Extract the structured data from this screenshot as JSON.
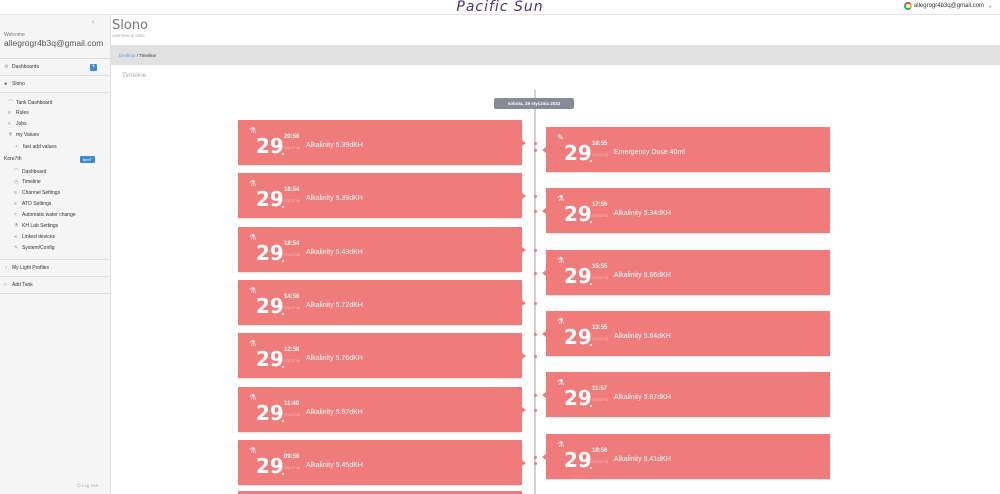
{
  "brand": "Pacific Sun",
  "user_email": "allegrogr4b3q@gmail.com",
  "user_caret": "▼",
  "sidebar": {
    "collapse_icon": "‹",
    "welcome": "Welcome",
    "email": "allegrogr4b3q@gmail.com",
    "items": [
      {
        "label": "Dashboards",
        "icon": "dashboard-icon"
      },
      {
        "label": "Slono",
        "icon": "fish-icon"
      },
      {
        "label": "Tank Dashboard",
        "icon": "chart-icon"
      },
      {
        "label": "Rules",
        "icon": "rules-icon"
      },
      {
        "label": "Jobs",
        "icon": "jobs-icon"
      },
      {
        "label": "my Values",
        "icon": "flask-icon"
      },
      {
        "label": "fast add values",
        "icon": "plus-icon"
      },
      {
        "label": "Kore7th",
        "icon": ""
      },
      {
        "label": "Dashboard",
        "icon": "chart-icon"
      },
      {
        "label": "Timeline",
        "icon": "clock-icon"
      },
      {
        "label": "Channel Settings",
        "icon": "sliders-icon"
      },
      {
        "label": "ATO Settings",
        "icon": "sliders-icon"
      },
      {
        "label": "Automatic water change",
        "icon": "water-icon"
      },
      {
        "label": "KH Lab Settings",
        "icon": "lab-icon"
      },
      {
        "label": "Linked devices",
        "icon": "link-icon"
      },
      {
        "label": "System/Config",
        "icon": "wrench-icon"
      },
      {
        "label": "My Light Profiles",
        "icon": "bulb-icon"
      },
      {
        "label": "Add Tank",
        "icon": "square-icon"
      }
    ],
    "badge": "beeT",
    "add_button": "+",
    "logout": "Log Out"
  },
  "page": {
    "title": "Slono",
    "subtitle": "overview & stats",
    "breadcrumb_home": "Desktop",
    "breadcrumb_sep": "/",
    "breadcrumb_current": "Timeline",
    "section": "Timeline"
  },
  "timeline": {
    "date_badge": "sobota, 29 stycznia 2022",
    "left": [
      {
        "day": "29",
        "time": "20:56",
        "month": "stycznia",
        "text": "Alkalinity 5.39dKH",
        "icon": "flask-icon"
      },
      {
        "day": "29",
        "time": "18:54",
        "month": "stycznia",
        "text": "Alkalinity 5.39dKH",
        "icon": "flask-icon"
      },
      {
        "day": "29",
        "time": "18:54",
        "month": "stycznia",
        "text": "Alkalinity 5.43dKH",
        "icon": "flask-icon"
      },
      {
        "day": "29",
        "time": "14:56",
        "month": "stycznia",
        "text": "Alkalinity 5.72dKH",
        "icon": "flask-icon"
      },
      {
        "day": "29",
        "time": "12:56",
        "month": "stycznia",
        "text": "Alkalinity 5.76dKH",
        "icon": "flask-icon"
      },
      {
        "day": "29",
        "time": "11:40",
        "month": "stycznia",
        "text": "Alkalinity 5.97dKH",
        "icon": "flask-icon"
      },
      {
        "day": "29",
        "time": "09:56",
        "month": "stycznia",
        "text": "Alkalinity 5.45dKH",
        "icon": "flask-icon"
      }
    ],
    "right": [
      {
        "day": "29",
        "time": "18:55",
        "month": "stycznia",
        "text": "Emergency Dose 40ml",
        "icon": "syringe-icon"
      },
      {
        "day": "29",
        "time": "17:55",
        "month": "stycznia",
        "text": "Alkalinity 5.34dKH",
        "icon": "flask-icon"
      },
      {
        "day": "29",
        "time": "15:55",
        "month": "stycznia",
        "text": "Alkalinity 5.66dKH",
        "icon": "flask-icon"
      },
      {
        "day": "29",
        "time": "13:55",
        "month": "stycznia",
        "text": "Alkalinity 5.64dKH",
        "icon": "flask-icon"
      },
      {
        "day": "29",
        "time": "11:57",
        "month": "stycznia",
        "text": "Alkalinity 5.87dKH",
        "icon": "flask-icon"
      },
      {
        "day": "29",
        "time": "10:56",
        "month": "stycznia",
        "text": "Alkalinity 5.41dKH",
        "icon": "flask-icon"
      }
    ]
  },
  "colors": {
    "card": "#ef7b7b",
    "badge": "#878a97",
    "accent": "#3a8ecf"
  }
}
